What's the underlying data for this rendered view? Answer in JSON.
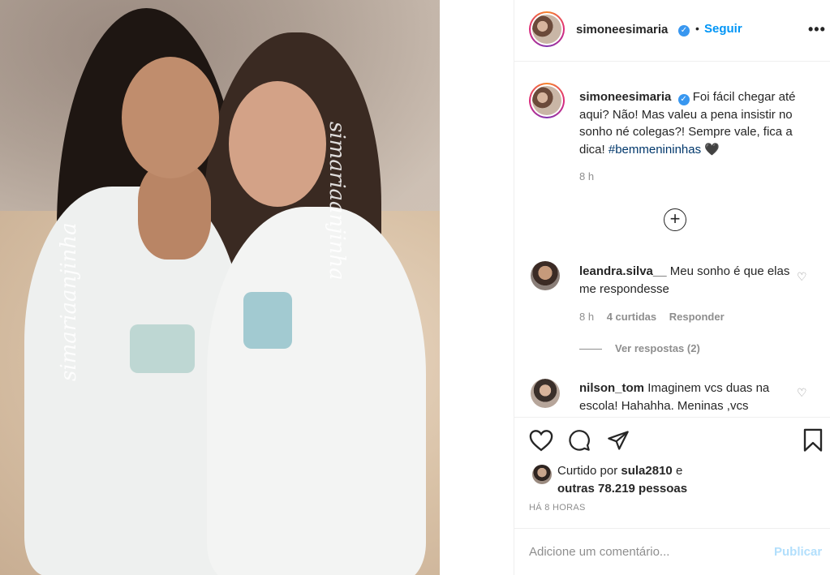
{
  "photo": {
    "watermark_left": "simariaanjinha",
    "watermark_right": "simariaanjinha"
  },
  "header": {
    "username": "simoneesimaria",
    "verified_glyph": "✓",
    "separator": "•",
    "follow_label": "Seguir",
    "more_icon": "more-options-icon",
    "more_glyph": "•••"
  },
  "caption": {
    "username": "simoneesimaria",
    "text": "Foi fácil chegar até aqui? Não! Mas valeu a pena insistir no sonho né colegas?! Sempre vale, fica a dica!",
    "hashtag": "#bemmenininhas",
    "emoji": "🖤",
    "time": "8 h"
  },
  "load_more_glyph": "+",
  "comments": [
    {
      "username": "leandra.silva__",
      "text": "Meu sonho é que elas me respondesse",
      "time": "8 h",
      "likes": "4 curtidas",
      "reply_label": "Responder",
      "view_replies": "Ver respostas (2)"
    },
    {
      "username": "nilson_tom",
      "text": "Imaginem vcs duas na escola! Hahahha. Meninas ,vcs"
    }
  ],
  "heart_glyph": "♡",
  "likes": {
    "prefix": "Curtido por",
    "user": "sula2810",
    "conj": "e",
    "others": "outras 78.219 pessoas"
  },
  "timestamp": "HÁ 8 HORAS",
  "add_comment": {
    "placeholder": "Adicione um comentário...",
    "publish_label": "Publicar"
  },
  "colors": {
    "accent": "#0095f6",
    "publish_disabled": "#b2dffc",
    "verified": "#3897f0",
    "muted": "#8e8e8e",
    "text": "#262626"
  }
}
